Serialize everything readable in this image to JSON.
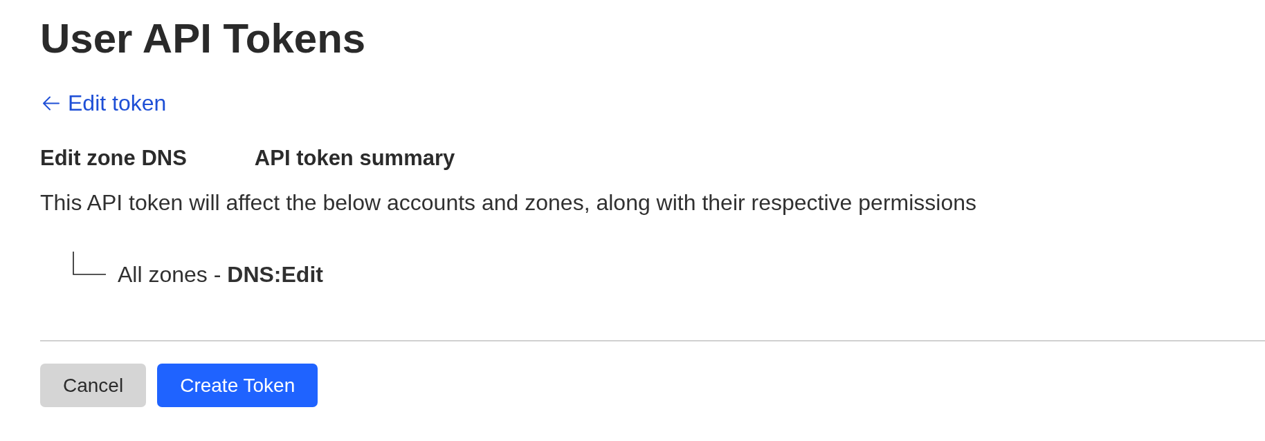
{
  "page": {
    "title": "User API Tokens"
  },
  "back_link": {
    "label": "Edit token"
  },
  "token": {
    "name": "Edit zone DNS",
    "summary_heading": "API token summary",
    "description": "This API token will affect the below accounts and zones, along with their respective permissions",
    "resources": [
      {
        "label": "All zones - **DNS:Edit**"
      }
    ]
  },
  "actions": [
    {
      "label": "Cancel",
      "kind": "secondary"
    },
    {
      "label": "Create Token",
      "kind": "primary"
    }
  ]
}
